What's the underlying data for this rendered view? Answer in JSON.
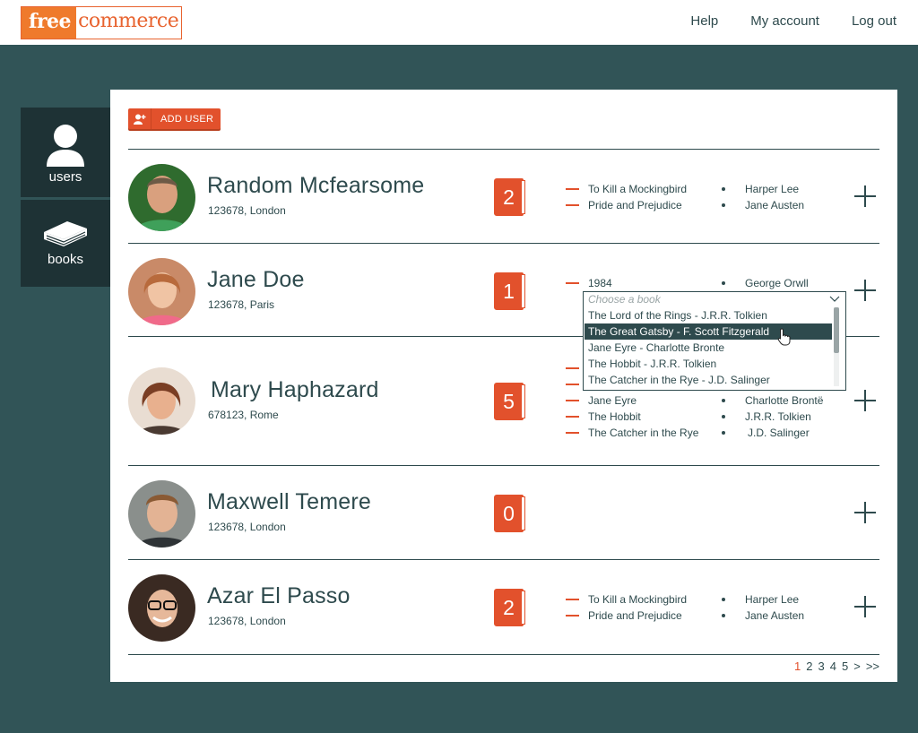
{
  "brand": {
    "logo_free": "free",
    "logo_commerce": "commerce"
  },
  "topnav": {
    "help": "Help",
    "account": "My account",
    "logout": "Log out"
  },
  "sidebar": {
    "users": "users",
    "books": "books"
  },
  "toolbar": {
    "add_user": "ADD USER"
  },
  "users": [
    {
      "name": "Random Mcfearsome",
      "location": "123678, London",
      "count": "2",
      "books": [
        {
          "title": "To Kill a Mockingbird",
          "author": "Harper Lee"
        },
        {
          "title": "Pride and Prejudice",
          "author": "Jane Austen"
        }
      ]
    },
    {
      "name": "Jane Doe",
      "location": "123678, Paris",
      "count": "1",
      "books": [
        {
          "title": "1984",
          "author": "George Orwll"
        }
      ]
    },
    {
      "name": "Mary Haphazard",
      "location": "678123, Rome",
      "count": "5",
      "books": [
        {
          "title": "Jane Eyre",
          "author": "Charlotte Brontë"
        },
        {
          "title": "The Hobbit",
          "author": "J.R.R. Tolkien"
        },
        {
          "title": "The Catcher in the Rye",
          "author": "J.D. Salinger"
        }
      ]
    },
    {
      "name": "Maxwell Temere",
      "location": "123678, London",
      "count": "0",
      "books": []
    },
    {
      "name": "Azar El Passo",
      "location": "123678, London",
      "count": "2",
      "books": [
        {
          "title": "To Kill a Mockingbird",
          "author": "Harper Lee"
        },
        {
          "title": "Pride and Prejudice",
          "author": "Jane Austen"
        }
      ]
    }
  ],
  "book_select": {
    "placeholder": "Choose a book",
    "options": [
      "The Lord of the Rings  -  J.R.R. Tolkien",
      "The Great Gatsby  -  F. Scott Fitzgerald",
      "Jane Eyre  -  Charlotte Bronte",
      "The Hobbit  -  J.R.R. Tolkien",
      "The Catcher in the Rye  -  J.D. Salinger"
    ],
    "selected_index": 1
  },
  "pagination": {
    "pages": [
      "1",
      "2",
      "3",
      "4",
      "5"
    ],
    "next": ">",
    "last": ">>",
    "current": "1"
  },
  "colors": {
    "accent": "#e2512c",
    "dark": "#2e4a4d",
    "background": "#315457",
    "sidebar": "#1e3235"
  }
}
